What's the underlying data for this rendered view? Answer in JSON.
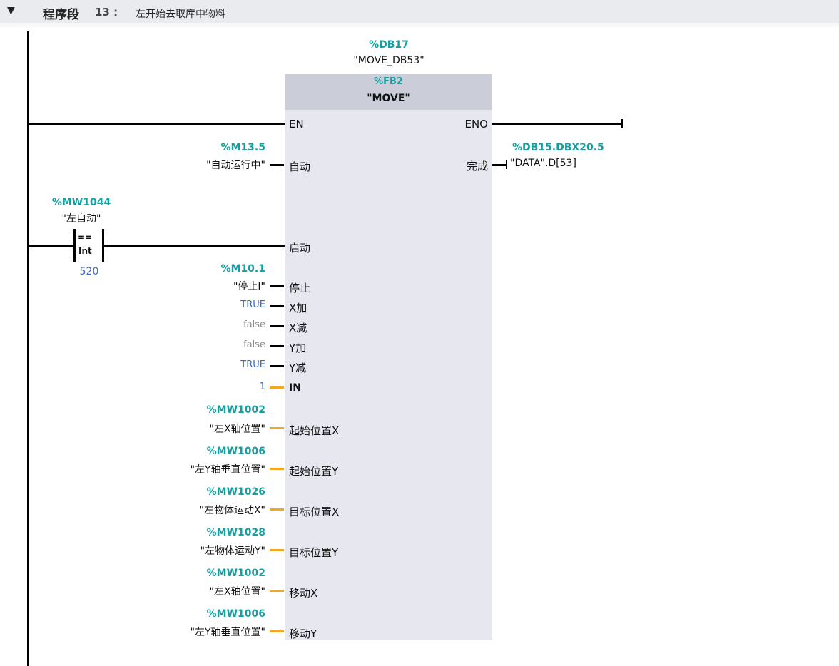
{
  "network": {
    "toggle": "▼",
    "label": "程序段",
    "number": "13 :",
    "comment": "左开始去取库中物料"
  },
  "instance": {
    "db_address": "%DB17",
    "db_name": "\"MOVE_DB53\""
  },
  "block": {
    "fb_address": "%FB2",
    "fb_name": "\"MOVE\"",
    "en": "EN",
    "eno": "ENO"
  },
  "comparator": {
    "address": "%MW1044",
    "tag": "\"左自动\"",
    "operator": "==",
    "type": "Int",
    "value": "520"
  },
  "inputs": [
    {
      "pin": "自动",
      "address": "%M13.5",
      "tag": "\"自动运行中\""
    },
    {
      "pin": "启动"
    },
    {
      "pin": "停止",
      "address": "%M10.1",
      "tag": "\"停止I\""
    },
    {
      "pin": "X加",
      "constant": "TRUE"
    },
    {
      "pin": "X减",
      "constant": "false"
    },
    {
      "pin": "Y加",
      "constant": "false"
    },
    {
      "pin": "Y减",
      "constant": "TRUE"
    },
    {
      "pin": "IN",
      "constant": "1"
    },
    {
      "pin": "起始位置X",
      "address": "%MW1002",
      "tag": "\"左X轴位置\""
    },
    {
      "pin": "起始位置Y",
      "address": "%MW1006",
      "tag": "\"左Y轴垂直位置\""
    },
    {
      "pin": "目标位置X",
      "address": "%MW1026",
      "tag": "\"左物体运动X\""
    },
    {
      "pin": "目标位置Y",
      "address": "%MW1028",
      "tag": "\"左物体运动Y\""
    },
    {
      "pin": "移动X",
      "address": "%MW1002",
      "tag": "\"左X轴位置\""
    },
    {
      "pin": "移动Y",
      "address": "%MW1006",
      "tag": "\"左Y轴垂直位置\""
    }
  ],
  "outputs": [
    {
      "pin": "完成",
      "address": "%DB15.DBX20.5",
      "tag": "\"DATA\".D[53]"
    }
  ],
  "colors": {
    "address": "#14a0a0",
    "bool_wire": "#000000",
    "int_wire": "#f5a623",
    "true_const": "#3a66c8",
    "false_const": "#8a8a8a"
  }
}
